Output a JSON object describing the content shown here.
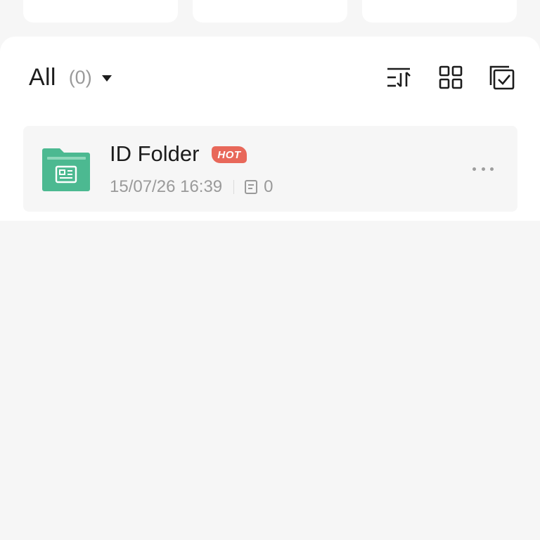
{
  "filter": {
    "label": "All",
    "count": "(0)",
    "dropdown_icon": "caret-down-icon"
  },
  "toolbar": {
    "sort_icon": "sort-icon",
    "grid_icon": "grid-view-icon",
    "select_icon": "multi-select-icon"
  },
  "folders": [
    {
      "name": "ID Folder",
      "badge": "HOT",
      "date": "15/07/26 16:39",
      "doc_count": "0",
      "icon": "id-folder-icon",
      "color": "#4cb991"
    }
  ],
  "colors": {
    "background": "#f6f6f6",
    "panel": "#ffffff",
    "folder_green": "#4cb991",
    "hot_badge": "#e8685a"
  }
}
